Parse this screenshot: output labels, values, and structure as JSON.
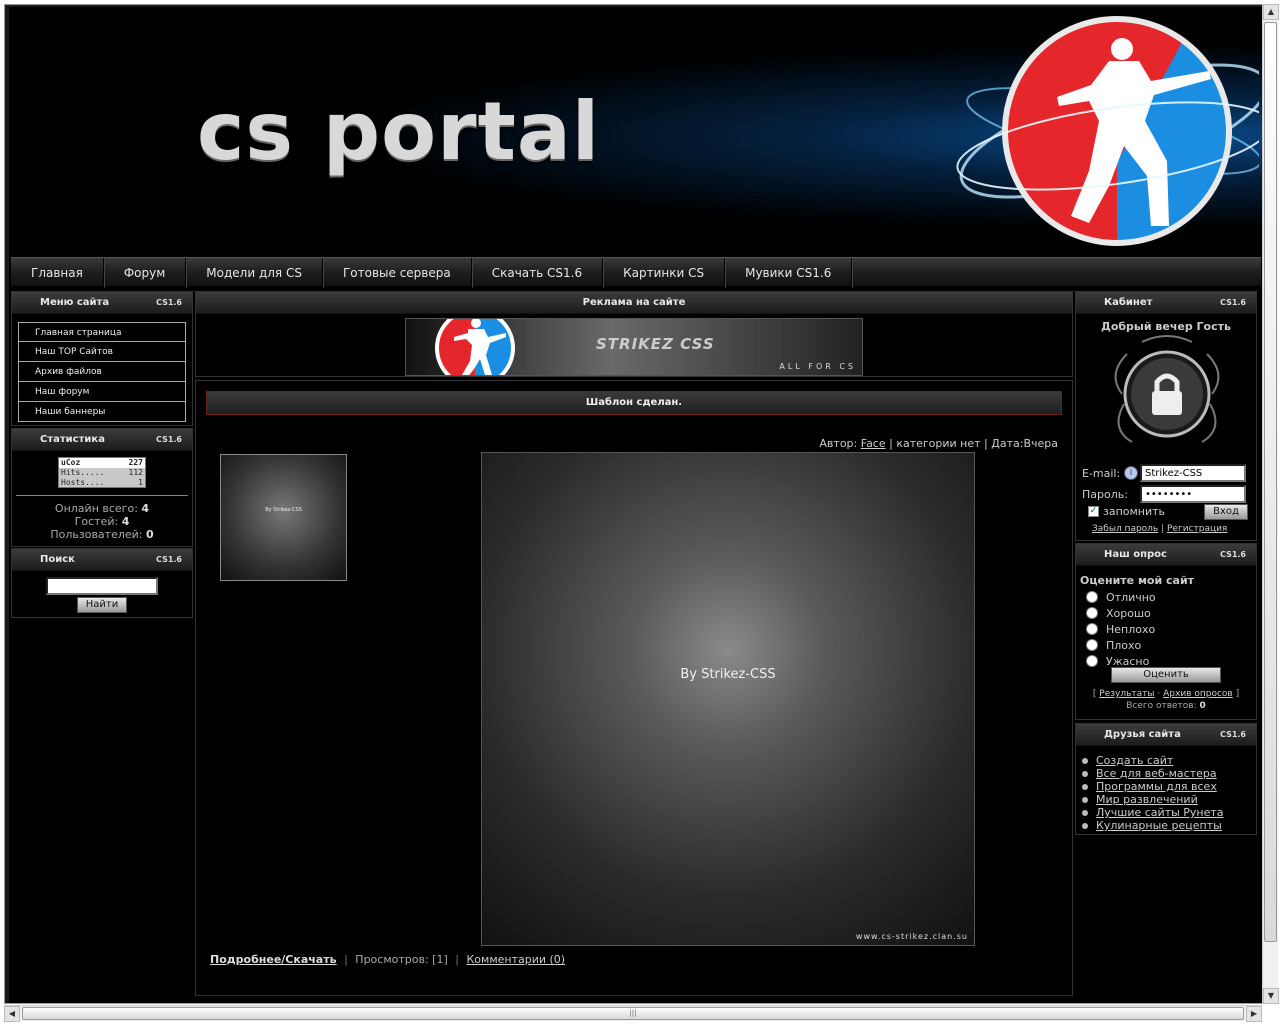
{
  "header": {
    "title": "cs portal"
  },
  "topnav": [
    "Главная",
    "Форум",
    "Модели для CS",
    "Готовые сервера",
    "Скачать CS1.6",
    "Картинки CS",
    "Мувики CS1.6"
  ],
  "panel_tag": "CS1.6",
  "menu": {
    "title": "Меню сайта",
    "items": [
      "Главная страница",
      "Наш TOP Сайтов",
      "Архив файлов",
      "Наш форум",
      "Наши баннеры"
    ]
  },
  "stats": {
    "title": "Статистика",
    "counter": {
      "brand": "uCoz",
      "brand_value": "227",
      "hits_label": "Hits.....",
      "hits": "112",
      "hosts_label": "Hosts....",
      "hosts": "1"
    },
    "online_label": "Онлайн всего:",
    "online": "4",
    "guests_label": "Гостей:",
    "guests": "4",
    "users_label": "Пользователей:",
    "users": "0"
  },
  "search": {
    "title": "Поиск",
    "value": "",
    "button": "Найти"
  },
  "ads": {
    "title": "Реклама на сайте",
    "banner_text": "STRIKEZ CSS",
    "banner_sub": "ALL FOR CS"
  },
  "entry": {
    "title": "Шаблон сделан.",
    "author_label": "Автор:",
    "author": "Face",
    "category": "категории нет",
    "date_label": "Дата:",
    "date": "Вчера",
    "thumb_caption": "By Strikez-CSS",
    "image_caption": "By Strikez-CSS",
    "image_url_mark": "www.cs-strikez.clan.su",
    "more": "Подробнее/Скачать",
    "views_label": "Просмотров:",
    "views": "[1]",
    "comments": "Комментарии (0)"
  },
  "cabinet": {
    "title": "Кабинет",
    "greeting": "Добрый вечер Гость",
    "email_label": "E-mail:",
    "email_value": "Strikez-CSS",
    "password_label": "Пароль:",
    "password_value": "••••••••",
    "remember": "запомнить",
    "login": "Вход",
    "forgot": "Забыл пароль",
    "register": "Регистрация"
  },
  "poll": {
    "title": "Наш опрос",
    "question": "Оцените мой сайт",
    "options": [
      "Отлично",
      "Хорошо",
      "Неплохо",
      "Плохо",
      "Ужасно"
    ],
    "vote": "Оценить",
    "results": "Результаты",
    "archive": "Архив опросов",
    "total_label": "Всего ответов:",
    "total": "0"
  },
  "friends": {
    "title": "Друзья сайта",
    "items": [
      "Создать сайт",
      "Все для веб-мастера",
      "Программы для всех",
      "Мир развлечений",
      "Лучшие сайты Рунета",
      "Кулинарные рецепты"
    ]
  },
  "colors": {
    "page_bg": "#000000",
    "accent_red": "#e8262b",
    "accent_blue": "#1a8fe0"
  }
}
